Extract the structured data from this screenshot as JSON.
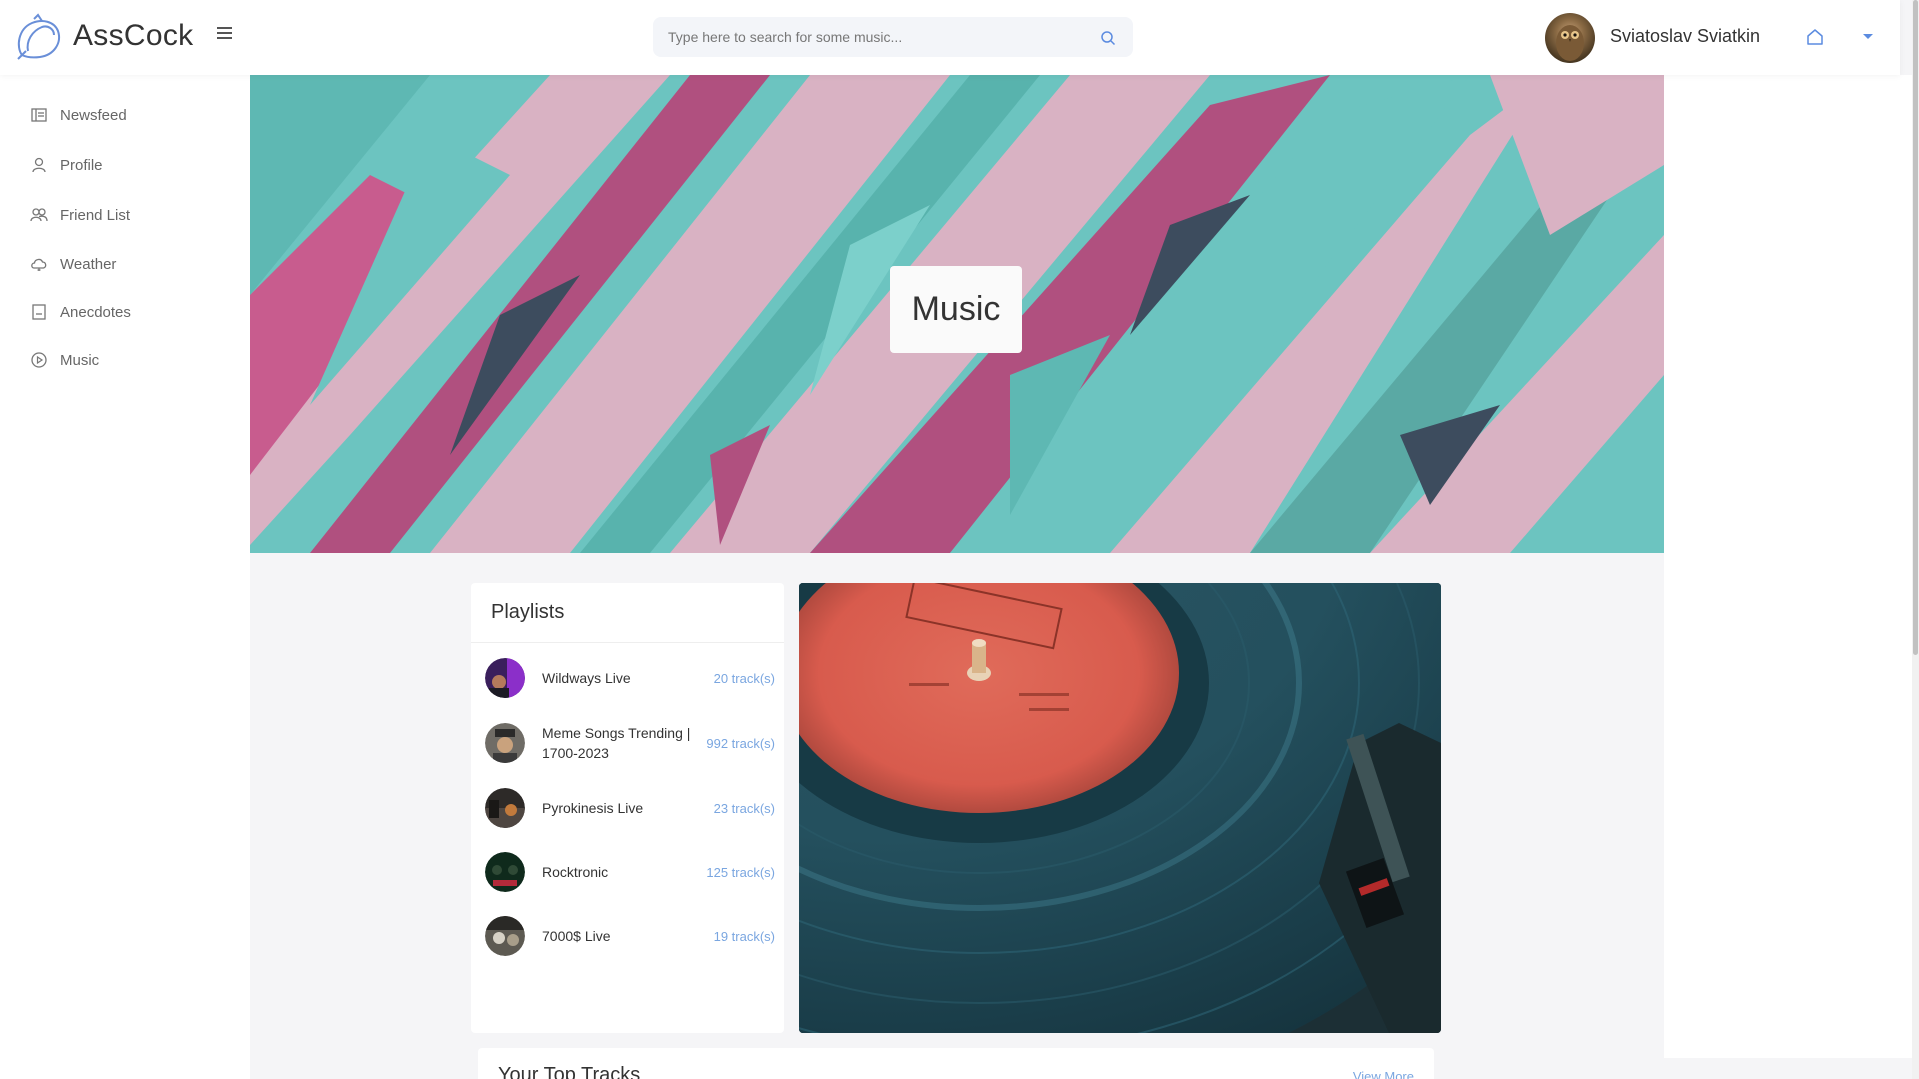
{
  "app": {
    "name": "AssCock"
  },
  "search": {
    "placeholder": "Type here to search for some music..."
  },
  "user": {
    "name": "Sviatoslav Sviatkin"
  },
  "sidebar": {
    "items": [
      {
        "label": "Newsfeed",
        "icon": "newsfeed-icon"
      },
      {
        "label": "Profile",
        "icon": "user-icon"
      },
      {
        "label": "Friend List",
        "icon": "users-icon"
      },
      {
        "label": "Weather",
        "icon": "cloud-icon"
      },
      {
        "label": "Anecdotes",
        "icon": "book-icon"
      },
      {
        "label": "Music",
        "icon": "play-circle-icon"
      }
    ]
  },
  "hero": {
    "title": "Music"
  },
  "playlists": {
    "title": "Playlists",
    "items": [
      {
        "name": "Wildways Live",
        "count": "20 track(s)"
      },
      {
        "name": "Meme Songs Trending | 1700-2023",
        "count": "992 track(s)"
      },
      {
        "name": "Pyrokinesis Live",
        "count": "23 track(s)"
      },
      {
        "name": "Rocktronic",
        "count": "125 track(s)"
      },
      {
        "name": "7000$ Live",
        "count": "19 track(s)"
      }
    ]
  },
  "top_tracks": {
    "title": "Your Top Tracks",
    "view_more": "View More"
  },
  "colors": {
    "accent": "#7aa6e0",
    "hero_teal": "#6bc3c0",
    "hero_pink": "#d9b3c4",
    "hero_magenta": "#b0507f"
  }
}
